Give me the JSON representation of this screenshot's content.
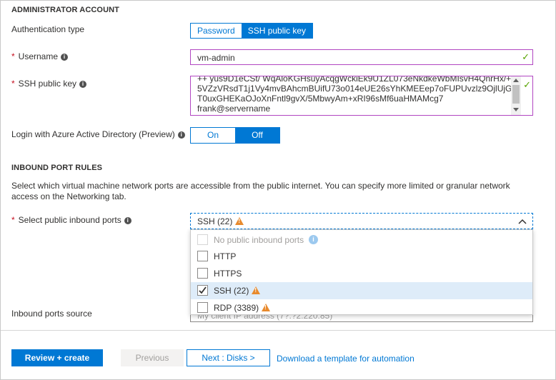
{
  "admin": {
    "section_title": "ADMINISTRATOR ACCOUNT",
    "auth_type_label": "Authentication type",
    "auth_options": [
      "Password",
      "SSH public key"
    ],
    "username_label": "Username",
    "username_value": "vm-admin",
    "ssh_key_label": "SSH public key",
    "ssh_key_lines": [
      "++ yus9D1eCSt/ WqAloKGHsuyAcqgWckiEk9U1ZL073eNkdkeWbMIsvH4QnrHx/+",
      "5VZzVRsdT1j1Vy4mvBAhcmBUifU73o014eUE26sYhKMEEep7oFUPUvzlz9OjlUjG3s",
      "T0uxGHEKaOJoXnFntl9gvX/5MbwyAm+xRI96sMf6uaHMAMcg7",
      "frank@servername"
    ],
    "aad_label": "Login with Azure Active Directory (Preview)",
    "aad_options": [
      "On",
      "Off"
    ]
  },
  "inbound": {
    "section_title": "INBOUND PORT RULES",
    "description_line1": "Select which virtual machine network ports are accessible from the public internet. You can specify more limited or granular network",
    "description_line2": "access on the Networking tab.",
    "ports_label": "Select public inbound ports",
    "ports_value": "SSH (22)",
    "options": [
      {
        "label": "No public inbound ports",
        "checked": false,
        "disabled": true
      },
      {
        "label": "HTTP",
        "checked": false,
        "disabled": false
      },
      {
        "label": "HTTPS",
        "checked": false,
        "disabled": false
      },
      {
        "label": "SSH (22)",
        "checked": true,
        "disabled": false,
        "warning": true
      },
      {
        "label": "RDP (3389)",
        "checked": false,
        "disabled": false,
        "warning": true
      }
    ],
    "source_label": "Inbound ports source",
    "source_value_partial": "My client IP address (7?.?2.220.85)"
  },
  "footer": {
    "review_label": "Review + create",
    "previous_label": "Previous",
    "next_label": "Next : Disks >",
    "template_link": "Download a template for automation"
  },
  "colors": {
    "accent": "#0078d4",
    "input_border": "#b146c2",
    "valid_check": "#57a300",
    "warning": "#e88a2d",
    "required": "#c50f1f"
  }
}
